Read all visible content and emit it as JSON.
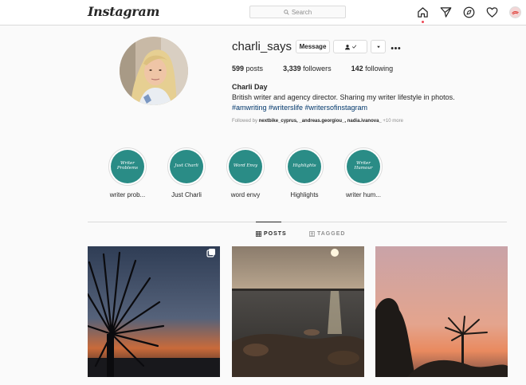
{
  "header": {
    "logo": "Instagram",
    "search_placeholder": "Search"
  },
  "profile": {
    "username": "charli_says",
    "message_label": "Message",
    "posts_count": "599",
    "posts_label": "posts",
    "followers_count": "3,339",
    "followers_label": "followers",
    "following_count": "142",
    "following_label": "following",
    "full_name": "Charli Day",
    "bio": "British writer and agency director. Sharing my writer lifestyle in photos.",
    "hashtags": "#amwriting #writerslife #writersofinstagram",
    "followed_by_prefix": "Followed by",
    "followed_by_names": "nextbike_cyprus, _andreas.georgiou_, nadia.ivanova_",
    "followed_by_more": "+10 more"
  },
  "highlights": [
    {
      "label": "writer prob...",
      "cover_text": "Writer Problems"
    },
    {
      "label": "Just Charli",
      "cover_text": "Just Charli"
    },
    {
      "label": "word envy",
      "cover_text": "Word Envy"
    },
    {
      "label": "Highlights",
      "cover_text": "Highlights"
    },
    {
      "label": "writer hum...",
      "cover_text": "Writer Humour"
    }
  ],
  "tabs": {
    "posts": "POSTS",
    "tagged": "TAGGED"
  },
  "colors": {
    "highlight_teal": "#2a8c86",
    "link_blue": "#00376b",
    "notification_red": "#ed4956"
  }
}
